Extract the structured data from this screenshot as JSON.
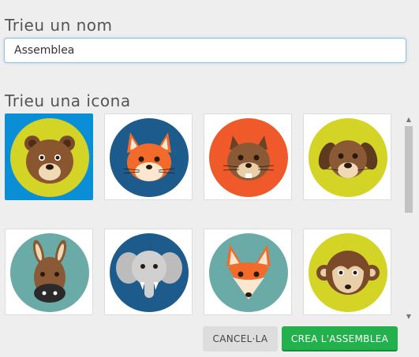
{
  "form": {
    "name_label": "Trieu un nom",
    "name_value": "Assemblea",
    "icon_label": "Trieu una icona"
  },
  "icons": [
    {
      "name": "bear-icon",
      "bg": "#d4d426",
      "selected": true
    },
    {
      "name": "fox-icon",
      "bg": "#1d5b8c",
      "selected": false
    },
    {
      "name": "squirrel-icon",
      "bg": "#f05a2a",
      "selected": false
    },
    {
      "name": "dog-icon",
      "bg": "#d4d426",
      "selected": false
    },
    {
      "name": "donkey-icon",
      "bg": "#6aaba8",
      "selected": false
    },
    {
      "name": "elephant-icon",
      "bg": "#1d5b8c",
      "selected": false
    },
    {
      "name": "fox-icon",
      "bg": "#6aaba8",
      "selected": false
    },
    {
      "name": "monkey-icon",
      "bg": "#d4d426",
      "selected": false
    }
  ],
  "buttons": {
    "cancel": "CANCEL·LA",
    "create": "CREA L'ASSEMBLEA"
  },
  "colors": {
    "selected_tile": "#0a8fd6",
    "create_button": "#22b14c"
  }
}
